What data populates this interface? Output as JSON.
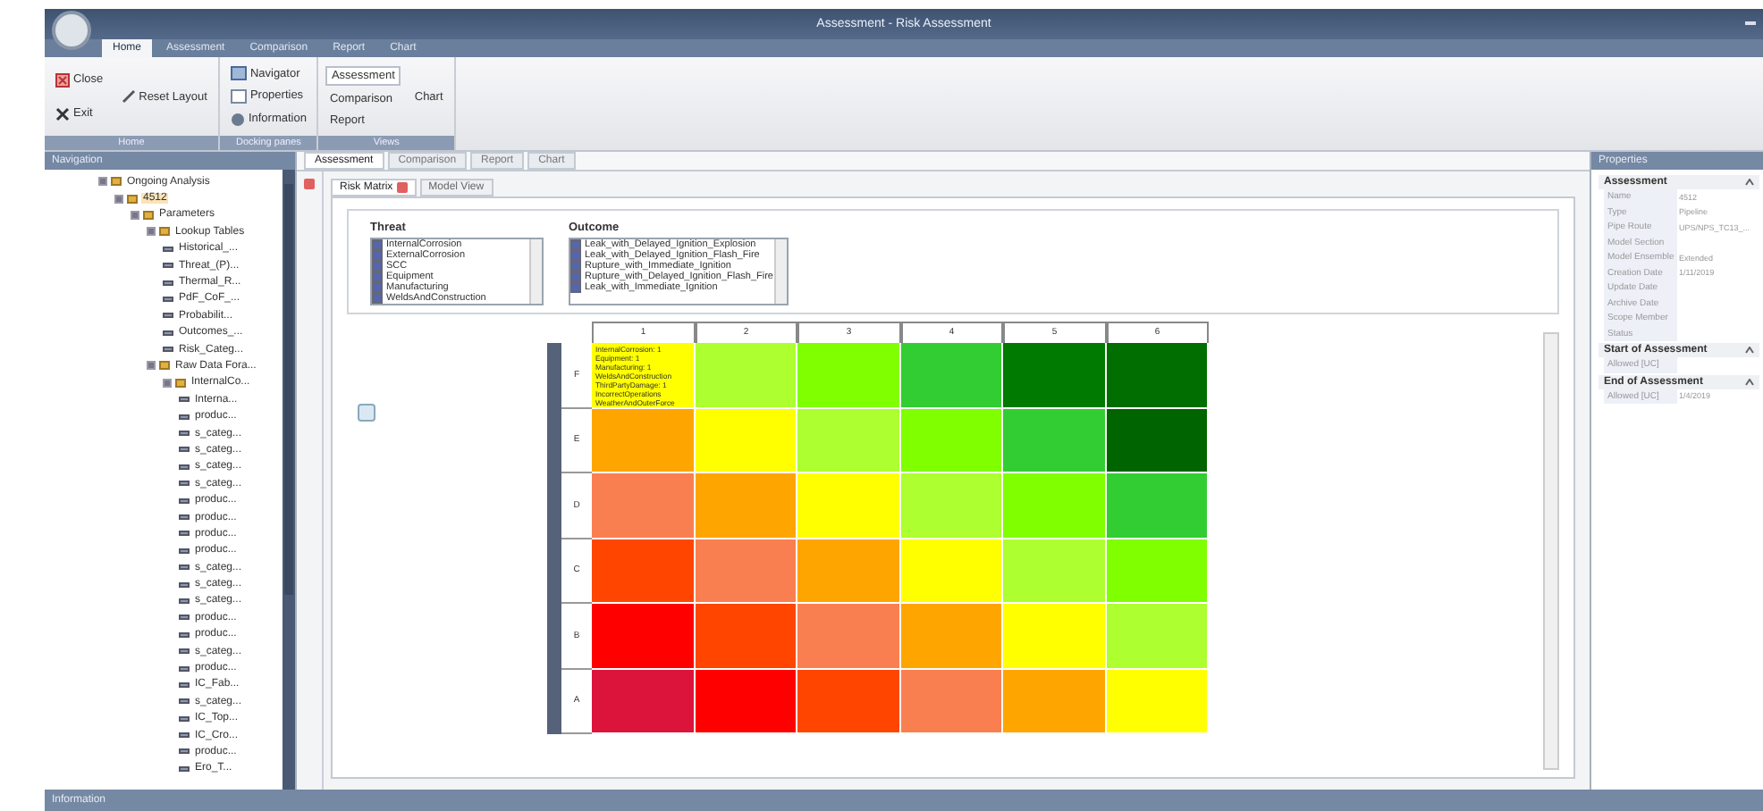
{
  "window": {
    "title": "Assessment - Risk Assessment"
  },
  "ribbon": {
    "tabs": [
      {
        "label": "Home",
        "selected": true
      },
      {
        "label": "Assessment",
        "selected": false
      },
      {
        "label": "Comparison",
        "selected": false
      },
      {
        "label": "Report",
        "selected": false
      },
      {
        "label": "Chart",
        "selected": false
      }
    ],
    "groups": [
      {
        "label": "Home",
        "columns": [
          [
            {
              "label": "Close"
            },
            {
              "label": "Exit"
            }
          ],
          [
            {
              "label": "Reset Layout"
            }
          ]
        ]
      },
      {
        "label": "Docking panes",
        "columns": [
          [
            {
              "label": "Navigator"
            },
            {
              "label": "Properties"
            },
            {
              "label": "Information"
            }
          ]
        ]
      },
      {
        "label": "Views",
        "columns": [
          [
            {
              "label": "Assessment",
              "selected": true
            },
            {
              "label": "Comparison",
              "selected": false
            },
            {
              "label": "Report",
              "selected": false
            }
          ],
          [
            {
              "label": "Chart",
              "selected": false
            }
          ]
        ]
      }
    ]
  },
  "navigation": {
    "title": "Navigation",
    "tree": [
      {
        "label": "Ongoing Analysis",
        "expanded": true,
        "children": [
          {
            "label": "4512",
            "selected": true,
            "expanded": true,
            "children": [
              {
                "label": "Parameters",
                "expanded": true,
                "children": [
                  {
                    "label": "Lookup Tables",
                    "expanded": true,
                    "children": [
                      {
                        "label": "Historical_..."
                      },
                      {
                        "label": "Threat_(P)..."
                      },
                      {
                        "label": "Thermal_R..."
                      },
                      {
                        "label": "PdF_CoF_..."
                      },
                      {
                        "label": "Probabilit..."
                      },
                      {
                        "label": "Outcomes_..."
                      },
                      {
                        "label": "Risk_Categ..."
                      }
                    ]
                  },
                  {
                    "label": "Raw Data Fora...",
                    "expanded": true,
                    "children": [
                      {
                        "label": "InternalCo...",
                        "expanded": true,
                        "children": [
                          {
                            "label": "Interna..."
                          },
                          {
                            "label": "produc..."
                          },
                          {
                            "label": "s_categ..."
                          },
                          {
                            "label": "s_categ..."
                          },
                          {
                            "label": "s_categ..."
                          },
                          {
                            "label": "s_categ..."
                          },
                          {
                            "label": "produc..."
                          },
                          {
                            "label": "produc..."
                          },
                          {
                            "label": "produc..."
                          },
                          {
                            "label": "produc..."
                          },
                          {
                            "label": "s_categ..."
                          },
                          {
                            "label": "s_categ..."
                          },
                          {
                            "label": "s_categ..."
                          },
                          {
                            "label": "produc..."
                          },
                          {
                            "label": "produc..."
                          },
                          {
                            "label": "s_categ..."
                          },
                          {
                            "label": "produc..."
                          },
                          {
                            "label": "IC_Fab..."
                          },
                          {
                            "label": "s_categ..."
                          },
                          {
                            "label": "IC_Top..."
                          },
                          {
                            "label": "IC_Cro..."
                          },
                          {
                            "label": "produc..."
                          },
                          {
                            "label": "Ero_T..."
                          }
                        ]
                      }
                    ]
                  }
                ]
              }
            ]
          }
        ]
      }
    ]
  },
  "document_tabs": [
    {
      "label": "Assessment",
      "selected": true
    },
    {
      "label": "Comparison",
      "selected": false
    },
    {
      "label": "Report",
      "selected": false
    },
    {
      "label": "Chart",
      "selected": false
    }
  ],
  "inner_tabs": [
    {
      "label": "Risk Matrix",
      "selected": true,
      "closable": true
    },
    {
      "label": "Model View",
      "selected": false,
      "closable": false
    }
  ],
  "filters": [
    {
      "label": "Threat",
      "items": [
        {
          "label": "InternalCorrosion",
          "checked": true
        },
        {
          "label": "ExternalCorrosion",
          "checked": true
        },
        {
          "label": "SCC",
          "checked": true
        },
        {
          "label": "Equipment",
          "checked": true
        },
        {
          "label": "Manufacturing",
          "checked": true
        },
        {
          "label": "WeldsAndConstruction",
          "checked": true
        }
      ]
    },
    {
      "label": "Outcome",
      "items": [
        {
          "label": "Leak_with_Delayed_Ignition_Explosion",
          "checked": true
        },
        {
          "label": "Leak_with_Delayed_Ignition_Flash_Fire",
          "checked": true
        },
        {
          "label": "Rupture_with_Immediate_Ignition",
          "checked": true
        },
        {
          "label": "Rupture_with_Delayed_Ignition_Flash_Fire",
          "checked": true
        },
        {
          "label": "Leak_with_Immediate_Ignition",
          "checked": true
        }
      ]
    }
  ],
  "risk_matrix": {
    "column_labels": [
      "1",
      "2",
      "3",
      "4",
      "5",
      "6"
    ],
    "rows": [
      {
        "label": "F",
        "cells": [
          {
            "color": "#ffff00",
            "lines": [
              "InternalCorrosion: 1",
              "Equipment: 1",
              "Manufacturing: 1",
              "WeldsAndConstruction",
              "ThirdPartyDamage: 1",
              "IncorrectOperations",
              "WeatherAndOuterForce"
            ]
          },
          {
            "color": "#adff2f"
          },
          {
            "color": "#7fff00"
          },
          {
            "color": "#32cd32"
          },
          {
            "color": "#007a00"
          },
          {
            "color": "#006e00"
          }
        ]
      },
      {
        "label": "E",
        "cells": [
          {
            "color": "#ffa500"
          },
          {
            "color": "#ffff00"
          },
          {
            "color": "#adff2f"
          },
          {
            "color": "#7fff00"
          },
          {
            "color": "#32cd32"
          },
          {
            "color": "#006400"
          }
        ]
      },
      {
        "label": "D",
        "cells": [
          {
            "color": "#fa7f50"
          },
          {
            "color": "#ffa500"
          },
          {
            "color": "#ffff00"
          },
          {
            "color": "#adff2f"
          },
          {
            "color": "#7fff00"
          },
          {
            "color": "#32cd32"
          }
        ]
      },
      {
        "label": "C",
        "cells": [
          {
            "color": "#ff4500"
          },
          {
            "color": "#fa7f50"
          },
          {
            "color": "#ffa500"
          },
          {
            "color": "#ffff00"
          },
          {
            "color": "#adff2f"
          },
          {
            "color": "#7fff00"
          }
        ]
      },
      {
        "label": "B",
        "cells": [
          {
            "color": "#ff0000"
          },
          {
            "color": "#ff4500"
          },
          {
            "color": "#fa7f50"
          },
          {
            "color": "#ffa500"
          },
          {
            "color": "#ffff00"
          },
          {
            "color": "#adff2f"
          }
        ]
      },
      {
        "label": "A",
        "cells": [
          {
            "color": "#dc143c"
          },
          {
            "color": "#ff0000"
          },
          {
            "color": "#ff4500"
          },
          {
            "color": "#fa7f50"
          },
          {
            "color": "#ffa500"
          },
          {
            "color": "#ffff00"
          }
        ]
      }
    ]
  },
  "properties": {
    "title": "Properties",
    "categories": [
      {
        "name": "Assessment",
        "expanded": true,
        "rows": [
          {
            "name": "Name",
            "value": "4512"
          },
          {
            "name": "Type",
            "value": "Pipeline"
          },
          {
            "name": "Pipe Route",
            "value": "UPS/NPS_TC13_..."
          },
          {
            "name": "Model Section"
          },
          {
            "name": "Model Ensemble",
            "value": "Extended"
          },
          {
            "name": "Creation Date",
            "value": "1/11/2019"
          },
          {
            "name": "Update Date"
          },
          {
            "name": "Archive Date"
          },
          {
            "name": "Scope Member"
          },
          {
            "name": "Status"
          }
        ]
      },
      {
        "name": "Start of Assessment",
        "expanded": true,
        "rows": [
          {
            "name": "Allowed [UC]"
          }
        ]
      },
      {
        "name": "End of Assessment",
        "expanded": true,
        "rows": [
          {
            "name": "Allowed [UC]",
            "value": "1/4/2019"
          }
        ]
      }
    ]
  },
  "information": {
    "title": "Information"
  }
}
